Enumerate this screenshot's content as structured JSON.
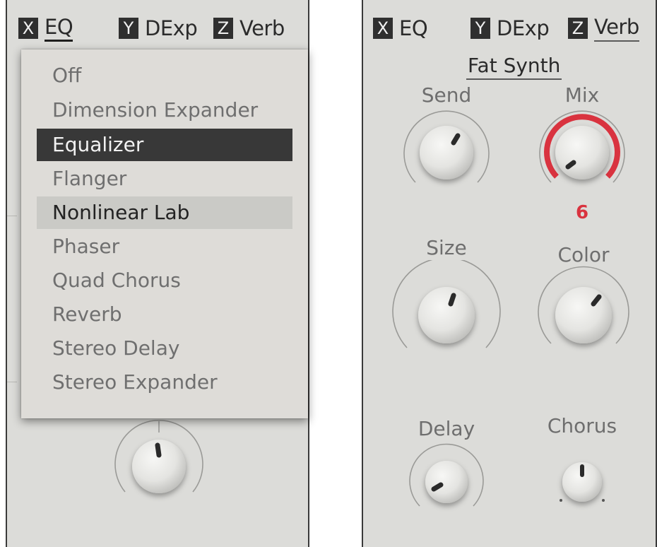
{
  "left_panel": {
    "tabs": [
      {
        "slot": "X",
        "name": "EQ"
      },
      {
        "slot": "Y",
        "name": "DExp"
      },
      {
        "slot": "Z",
        "name": "Verb"
      }
    ],
    "active_tab": "EQ",
    "effect_menu": {
      "items": [
        "Off",
        "Dimension Expander",
        "Equalizer",
        "Flanger",
        "Nonlinear Lab",
        "Phaser",
        "Quad Chorus",
        "Reverb",
        "Stereo Delay",
        "Stereo Expander"
      ],
      "selected": "Equalizer",
      "hovered": "Nonlinear Lab"
    }
  },
  "right_panel": {
    "tabs": [
      {
        "slot": "X",
        "name": "EQ"
      },
      {
        "slot": "Y",
        "name": "DExp"
      },
      {
        "slot": "Z",
        "name": "Verb"
      }
    ],
    "active_tab": "Verb",
    "preset_name": "Fat Synth",
    "knobs": {
      "send": {
        "label": "Send"
      },
      "mix": {
        "label": "Mix",
        "value": "6"
      },
      "size": {
        "label": "Size"
      },
      "color": {
        "label": "Color"
      },
      "delay": {
        "label": "Delay"
      },
      "chorus": {
        "label": "Chorus"
      }
    }
  },
  "colors": {
    "panel_bg": "#dcdcd9",
    "active_arc": "#d9333f",
    "selected_item_bg": "#383838",
    "hovered_item_bg": "#cacac6"
  }
}
